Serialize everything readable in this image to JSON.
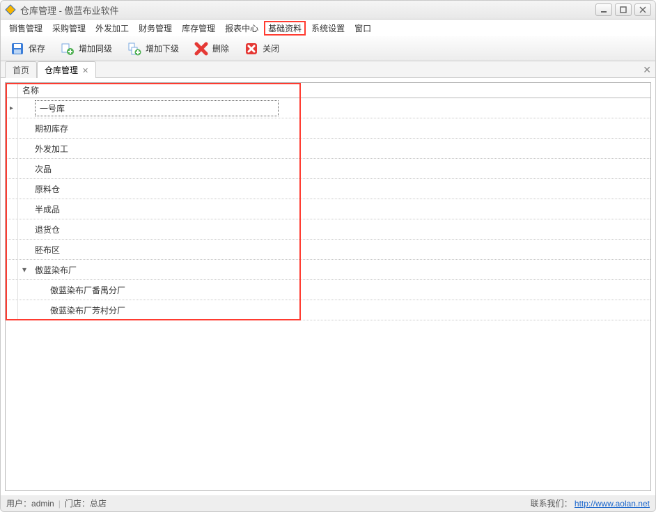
{
  "title": "仓库管理 - 傲蓝布业软件",
  "menus": [
    "销售管理",
    "采购管理",
    "外发加工",
    "财务管理",
    "库存管理",
    "报表中心",
    "基础资料",
    "系统设置",
    "窗口"
  ],
  "highlighted_menu_index": 6,
  "toolbar": {
    "save": "保存",
    "add_sibling": "增加同级",
    "add_child": "增加下级",
    "delete": "删除",
    "close": "关闭"
  },
  "tabs": [
    {
      "label": "首页",
      "closable": false,
      "active": false
    },
    {
      "label": "仓库管理",
      "closable": true,
      "active": true
    }
  ],
  "grid": {
    "header": "名称",
    "rows": [
      {
        "label": "一号库",
        "selected": true,
        "current": true,
        "depth": 0
      },
      {
        "label": "期初库存",
        "depth": 0
      },
      {
        "label": "外发加工",
        "depth": 0
      },
      {
        "label": "次品",
        "depth": 0
      },
      {
        "label": "原料仓",
        "depth": 0
      },
      {
        "label": "半成品",
        "depth": 0
      },
      {
        "label": "退货仓",
        "depth": 0
      },
      {
        "label": "胚布区",
        "depth": 0
      },
      {
        "label": "傲蓝染布厂",
        "depth": 0,
        "expander": "open"
      },
      {
        "label": "傲蓝染布厂番禺分厂",
        "depth": 1
      },
      {
        "label": "傲蓝染布厂芳村分厂",
        "depth": 1
      }
    ]
  },
  "status": {
    "user_label": "用户：",
    "user": "admin",
    "store_label": "门店：",
    "store": "总店",
    "contact_label": "联系我们：",
    "link_text": "http://www.aolan.net"
  }
}
